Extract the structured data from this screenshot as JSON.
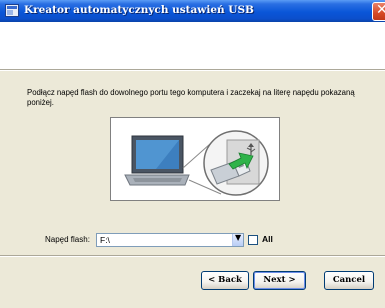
{
  "window": {
    "title": "Kreator automatycznych ustawień USB",
    "close_symbol": "✕"
  },
  "instruction": "Podłącz napęd flash do dowolnego portu tego komputera i zaczekaj na literę napędu pokazaną poniżej.",
  "illustration": {
    "icons": [
      "laptop-icon",
      "usb-flash-drive-icon",
      "usb-symbol-icon",
      "green-arrow-icon"
    ]
  },
  "drive": {
    "label": "Napęd flash:",
    "selected": "F:\\",
    "all_label": "All",
    "all_checked": false
  },
  "buttons": {
    "back": "< Back",
    "next": "Next >",
    "cancel": "Cancel"
  },
  "colors": {
    "titlebar": "#0a56d8",
    "dialog_bg": "#ece9d8",
    "accent_green": "#2fb34a"
  }
}
